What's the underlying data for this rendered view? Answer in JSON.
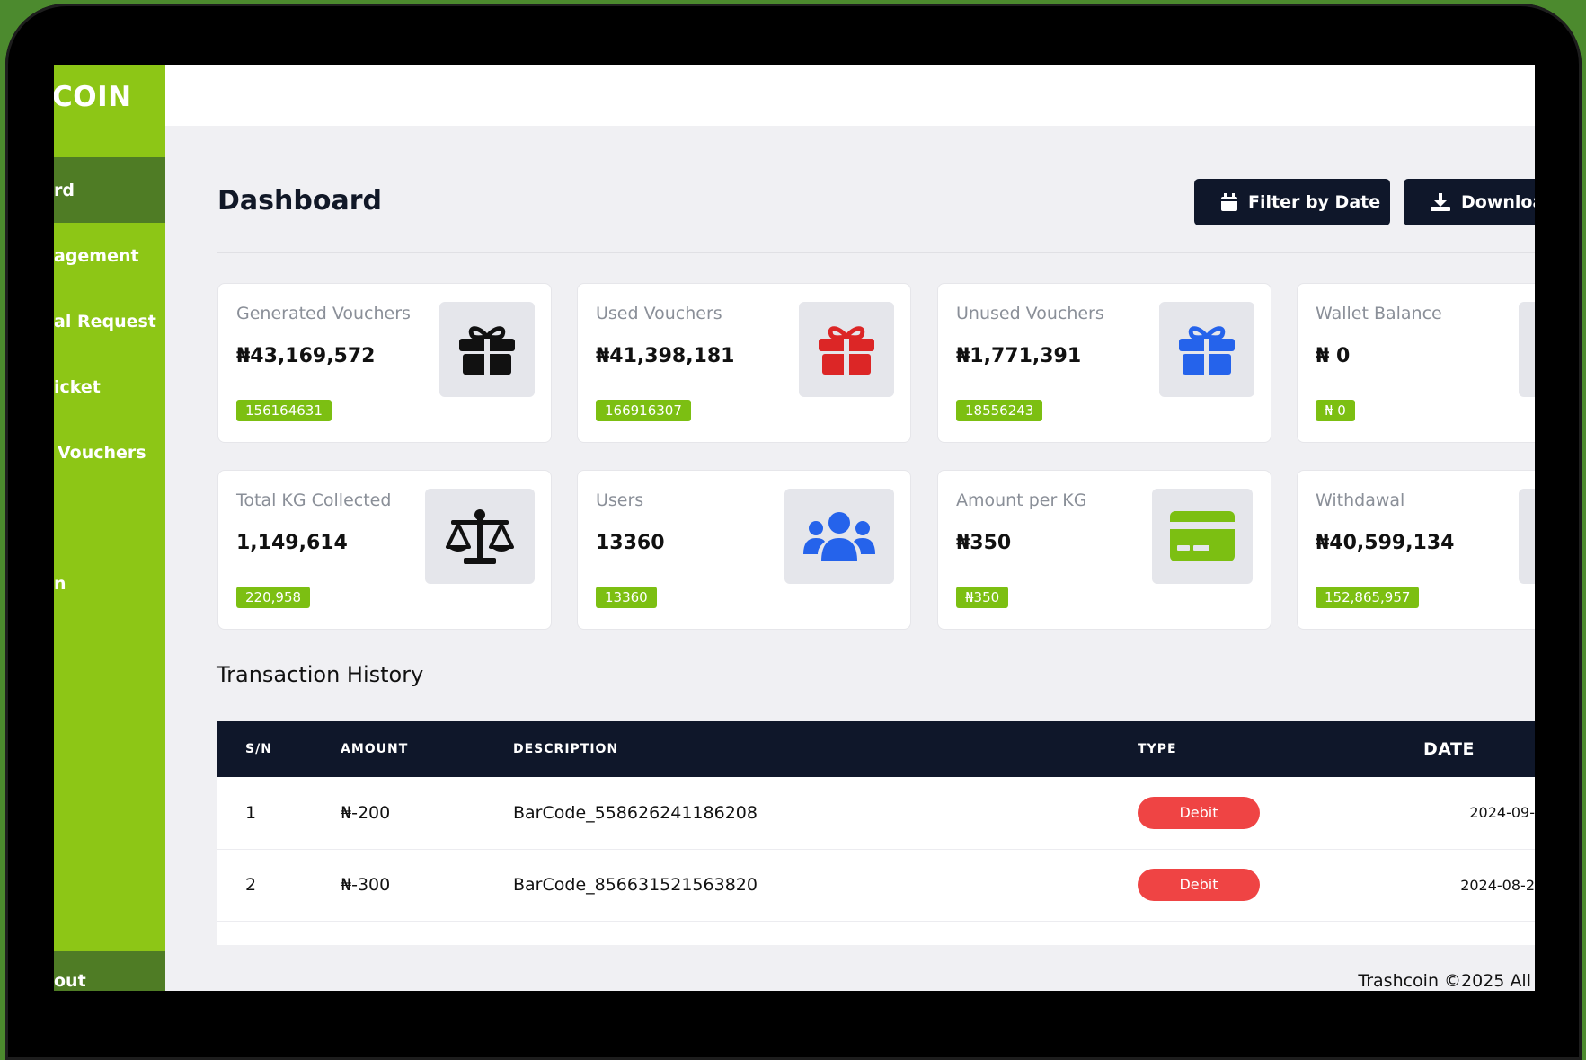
{
  "sidebar": {
    "brand": "COIN",
    "items": [
      {
        "label": "rd"
      },
      {
        "label": "agement"
      },
      {
        "label": "al Request"
      },
      {
        "label": "icket"
      },
      {
        "label": "Vouchers"
      },
      {
        "label": "n"
      }
    ],
    "logout": "out"
  },
  "header": {
    "title": "Dashboard",
    "filter_label": "Filter by Date",
    "download_label": "Downloa"
  },
  "cards": [
    {
      "label": "Generated Vouchers",
      "value": "₦43,169,572",
      "badge": "156164631",
      "icon": "gift-icon",
      "icon_color": "#111111"
    },
    {
      "label": "Used Vouchers",
      "value": "₦41,398,181",
      "badge": "166916307",
      "icon": "gift-icon",
      "icon_color": "#dc2626"
    },
    {
      "label": "Unused Vouchers",
      "value": "₦1,771,391",
      "badge": "18556243",
      "icon": "gift-icon",
      "icon_color": "#2563eb"
    },
    {
      "label": "Wallet Balance",
      "value": "₦ 0",
      "badge": "₦ 0"
    },
    {
      "label": "Total KG Collected",
      "value": "1,149,614",
      "badge": "220,958",
      "icon": "scale-icon",
      "icon_color": "#111111"
    },
    {
      "label": "Users",
      "value": "13360",
      "badge": "13360",
      "icon": "users-icon",
      "icon_color": "#2563eb"
    },
    {
      "label": "Amount per KG",
      "value": "₦350",
      "badge": "₦350",
      "icon": "credit-card-icon",
      "icon_color": "#7cbf12"
    },
    {
      "label": "Withdawal",
      "value": "₦40,599,134",
      "badge": "152,865,957"
    }
  ],
  "transactions": {
    "title": "Transaction History",
    "columns": [
      "S/N",
      "AMOUNT",
      "DESCRIPTION",
      "TYPE",
      "DATE"
    ],
    "rows": [
      {
        "sn": "1",
        "amount": "₦-200",
        "description": "BarCode_558626241186208",
        "type": "Debit",
        "date": "2024-09-"
      },
      {
        "sn": "2",
        "amount": "₦-300",
        "description": "BarCode_856631521563820",
        "type": "Debit",
        "date": "2024-08-2"
      }
    ]
  },
  "footer": {
    "text": "Trashcoin ©2025 All"
  },
  "colors": {
    "brand_green": "#8dc616",
    "dark_navy": "#0f172a",
    "debit_red": "#ef4444"
  }
}
